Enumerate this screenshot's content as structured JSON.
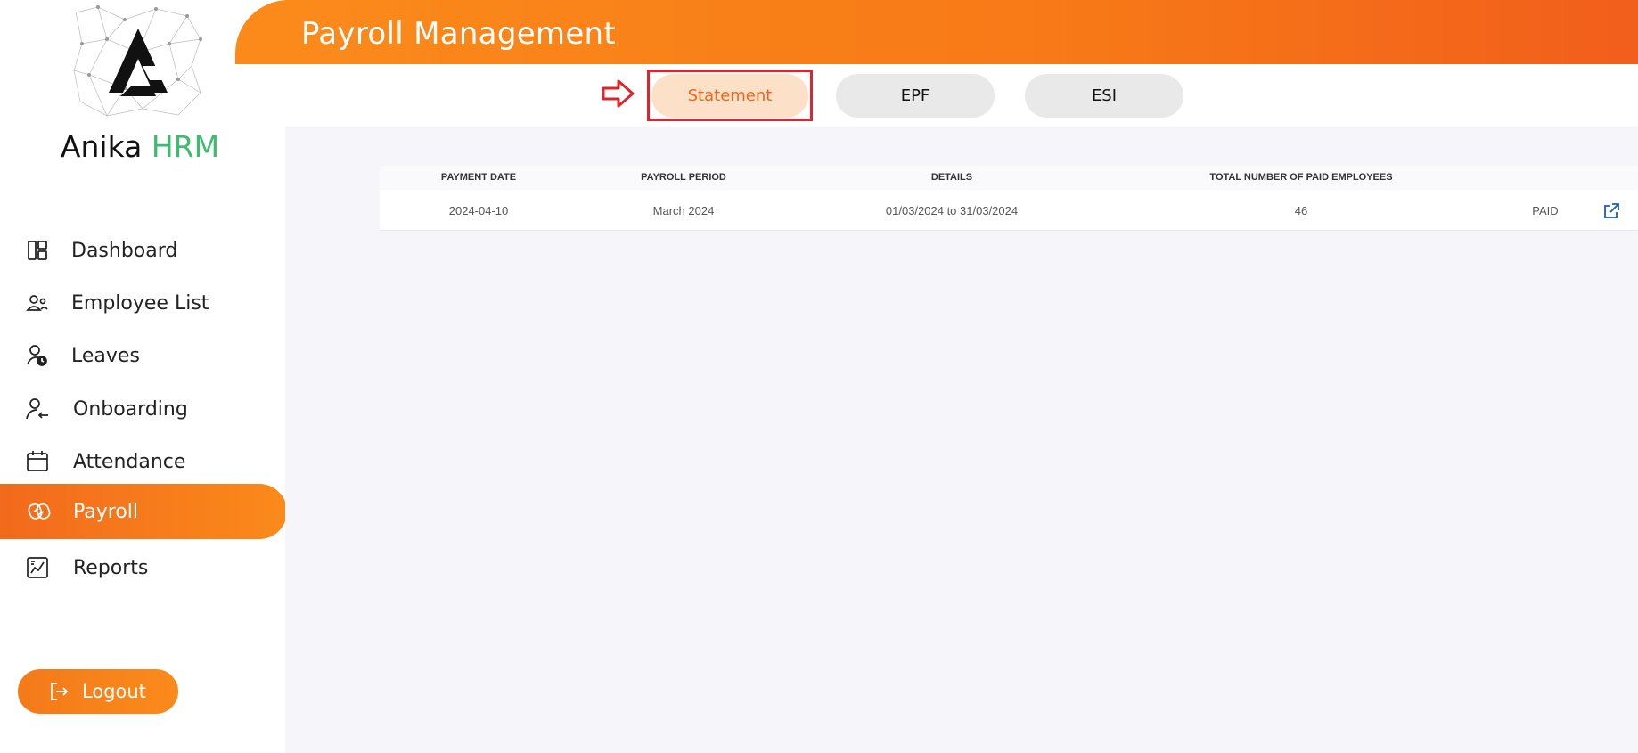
{
  "app": {
    "brand_name": "Anika",
    "brand_suffix": "HRM",
    "page_title": "Payroll Management"
  },
  "sidebar": {
    "items": [
      {
        "label": "Dashboard",
        "icon": "dashboard-icon"
      },
      {
        "label": "Employee List",
        "icon": "users-icon"
      },
      {
        "label": "Leaves",
        "icon": "user-clock-icon"
      },
      {
        "label": "Onboarding",
        "icon": "user-arrow-icon"
      },
      {
        "label": "Attendance",
        "icon": "calendar-icon"
      },
      {
        "label": "Payroll",
        "icon": "payroll-icon",
        "active": true
      },
      {
        "label": "Reports",
        "icon": "chart-icon"
      }
    ],
    "logout_label": "Logout"
  },
  "tabs": {
    "statement": "Statement",
    "epf": "EPF",
    "esi": "ESI",
    "active": "Statement"
  },
  "table": {
    "headers": {
      "payment_date": "PAYMENT DATE",
      "payroll_period": "PAYROLL PERIOD",
      "details": "DETAILS",
      "total": "TOTAL NUMBER OF PAID EMPLOYEES"
    },
    "rows": [
      {
        "payment_date": "2024-04-10",
        "payroll_period": "March 2024",
        "details": "01/03/2024 to 31/03/2024",
        "total": "46",
        "status": "PAID"
      }
    ]
  },
  "colors": {
    "accent": "#fb8a1b",
    "accent_dark": "#f25e1c",
    "brand_green": "#3dbb6f",
    "highlight_red": "#e0242b",
    "link_blue": "#1a5db8"
  }
}
